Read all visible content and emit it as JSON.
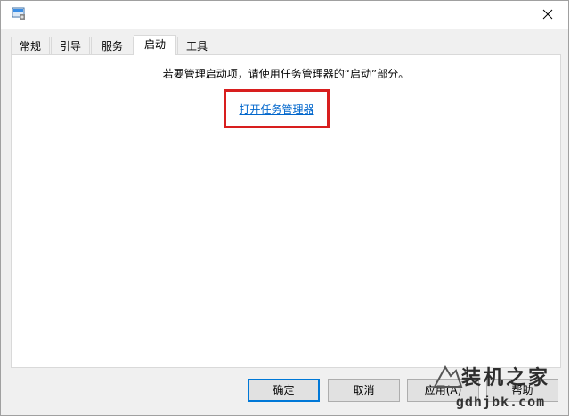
{
  "window": {
    "icon": "system-config-icon",
    "close_icon": "close-icon"
  },
  "tabs": [
    {
      "label": "常规",
      "active": false
    },
    {
      "label": "引导",
      "active": false
    },
    {
      "label": "服务",
      "active": false
    },
    {
      "label": "启动",
      "active": true
    },
    {
      "label": "工具",
      "active": false
    }
  ],
  "startup_panel": {
    "instruction": "若要管理启动项，请使用任务管理器的“启动”部分。",
    "link_label": "打开任务管理器",
    "highlight_color": "#d81e1e"
  },
  "buttons": {
    "ok": "确定",
    "cancel": "取消",
    "apply": "应用(A)",
    "help": "帮助"
  },
  "watermark": {
    "title": "装机之家",
    "url": "gdhjbk.com"
  },
  "colors": {
    "link": "#0066cc",
    "accent": "#0078d7"
  }
}
